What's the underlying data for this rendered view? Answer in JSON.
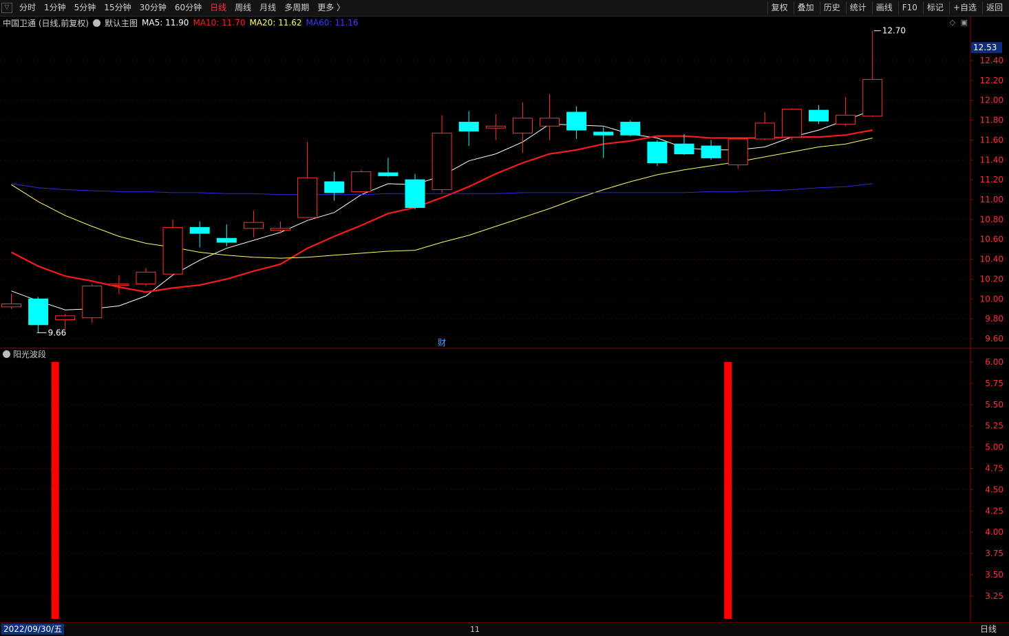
{
  "toolbar": {
    "periods": [
      "分时",
      "1分钟",
      "5分钟",
      "15分钟",
      "30分钟",
      "60分钟",
      "日线",
      "周线",
      "月线",
      "多周期",
      "更多 〉"
    ],
    "active_period": "日线",
    "buttons": [
      "复权",
      "叠加",
      "历史",
      "统计",
      "画线",
      "F10",
      "标记",
      "+自选",
      "返回"
    ]
  },
  "header": {
    "stock": "中国卫通 (日线,前复权)",
    "template": "默认主图",
    "ma5": "MA5: 11.90",
    "ma10": "MA10: 11.70",
    "ma20": "MA20: 11.62",
    "ma60": "MA60: 11.16"
  },
  "indicator_label": "阳光波段",
  "bottom": {
    "date": "2022/09/30/五",
    "month": "11",
    "period": "日线"
  },
  "colors": {
    "up": "#ff3232",
    "down": "#00ffff",
    "ma5": "#ffffff",
    "ma10": "#ff1a1a",
    "ma20": "#ffff66",
    "ma60": "#2a2ae6",
    "axis": "#8b0000",
    "bar": "#ff0000"
  },
  "chart_data": [
    {
      "type": "candlestick",
      "title": "中国卫通 (日线,前复权)",
      "ylim": [
        9.5,
        12.9
      ],
      "y_ticks": [
        9.6,
        9.8,
        10.0,
        10.2,
        10.4,
        10.6,
        10.8,
        11.0,
        11.2,
        11.4,
        11.6,
        11.8,
        12.0,
        12.2,
        12.4
      ],
      "current_price_tag": "12.53",
      "high_annotation": "12.70",
      "low_annotation": "9.66",
      "event_marker": "财",
      "candles": [
        {
          "o": 9.92,
          "h": 10.05,
          "l": 9.9,
          "c": 9.95
        },
        {
          "o": 10.0,
          "h": 10.02,
          "l": 9.66,
          "c": 9.74
        },
        {
          "o": 9.79,
          "h": 9.85,
          "l": 9.7,
          "c": 9.83
        },
        {
          "o": 9.81,
          "h": 10.15,
          "l": 9.76,
          "c": 10.13
        },
        {
          "o": 10.14,
          "h": 10.24,
          "l": 10.05,
          "c": 10.15
        },
        {
          "o": 10.15,
          "h": 10.31,
          "l": 10.13,
          "c": 10.27
        },
        {
          "o": 10.25,
          "h": 10.8,
          "l": 10.24,
          "c": 10.72
        },
        {
          "o": 10.72,
          "h": 10.78,
          "l": 10.52,
          "c": 10.66
        },
        {
          "o": 10.61,
          "h": 10.75,
          "l": 10.53,
          "c": 10.57
        },
        {
          "o": 10.71,
          "h": 10.89,
          "l": 10.62,
          "c": 10.77
        },
        {
          "o": 10.69,
          "h": 10.78,
          "l": 10.66,
          "c": 10.71
        },
        {
          "o": 10.82,
          "h": 11.58,
          "l": 10.82,
          "c": 11.22
        },
        {
          "o": 11.18,
          "h": 11.28,
          "l": 10.99,
          "c": 11.07
        },
        {
          "o": 11.08,
          "h": 11.3,
          "l": 11.07,
          "c": 11.28
        },
        {
          "o": 11.27,
          "h": 11.42,
          "l": 11.23,
          "c": 11.24
        },
        {
          "o": 11.2,
          "h": 11.26,
          "l": 10.9,
          "c": 10.92
        },
        {
          "o": 11.1,
          "h": 11.85,
          "l": 11.07,
          "c": 11.67
        },
        {
          "o": 11.78,
          "h": 11.89,
          "l": 11.54,
          "c": 11.69
        },
        {
          "o": 11.72,
          "h": 11.86,
          "l": 11.6,
          "c": 11.74
        },
        {
          "o": 11.67,
          "h": 11.98,
          "l": 11.47,
          "c": 11.82
        },
        {
          "o": 11.74,
          "h": 12.06,
          "l": 11.6,
          "c": 11.82
        },
        {
          "o": 11.88,
          "h": 11.94,
          "l": 11.61,
          "c": 11.7
        },
        {
          "o": 11.68,
          "h": 11.73,
          "l": 11.42,
          "c": 11.65
        },
        {
          "o": 11.78,
          "h": 11.8,
          "l": 11.64,
          "c": 11.65
        },
        {
          "o": 11.58,
          "h": 11.6,
          "l": 11.34,
          "c": 11.37
        },
        {
          "o": 11.56,
          "h": 11.66,
          "l": 11.45,
          "c": 11.46
        },
        {
          "o": 11.54,
          "h": 11.6,
          "l": 11.4,
          "c": 11.42
        },
        {
          "o": 11.35,
          "h": 11.62,
          "l": 11.31,
          "c": 11.61
        },
        {
          "o": 11.61,
          "h": 11.88,
          "l": 11.6,
          "c": 11.77
        },
        {
          "o": 11.63,
          "h": 11.92,
          "l": 11.6,
          "c": 11.91
        },
        {
          "o": 11.9,
          "h": 11.95,
          "l": 11.76,
          "c": 11.79
        },
        {
          "o": 11.76,
          "h": 12.03,
          "l": 11.74,
          "c": 11.85
        },
        {
          "o": 11.84,
          "h": 12.7,
          "l": 11.83,
          "c": 12.21
        }
      ],
      "ma_lines": [
        {
          "name": "MA5",
          "values": [
            10.08,
            9.98,
            9.89,
            9.9,
            9.93,
            10.03,
            10.24,
            10.39,
            10.51,
            10.59,
            10.67,
            10.79,
            10.87,
            11.05,
            11.16,
            11.15,
            11.24,
            11.39,
            11.46,
            11.58,
            11.76,
            11.75,
            11.74,
            11.66,
            11.62,
            11.52,
            11.5,
            11.5,
            11.53,
            11.63,
            11.7,
            11.8,
            11.9
          ]
        },
        {
          "name": "MA10",
          "values": [
            10.47,
            10.33,
            10.23,
            10.18,
            10.12,
            10.07,
            10.11,
            10.14,
            10.2,
            10.28,
            10.35,
            10.51,
            10.63,
            10.74,
            10.86,
            10.92,
            11.02,
            11.13,
            11.26,
            11.37,
            11.46,
            11.5,
            11.56,
            11.59,
            11.64,
            11.64,
            11.62,
            11.62,
            11.62,
            11.63,
            11.63,
            11.65,
            11.7
          ]
        },
        {
          "name": "MA20",
          "values": [
            11.15,
            10.98,
            10.84,
            10.73,
            10.63,
            10.56,
            10.52,
            10.47,
            10.44,
            10.42,
            10.41,
            10.42,
            10.44,
            10.46,
            10.48,
            10.49,
            10.57,
            10.64,
            10.73,
            10.82,
            10.91,
            11.01,
            11.1,
            11.18,
            11.25,
            11.3,
            11.34,
            11.38,
            11.43,
            11.48,
            11.53,
            11.56,
            11.62
          ]
        },
        {
          "name": "MA60",
          "values": [
            11.16,
            11.12,
            11.1,
            11.09,
            11.08,
            11.08,
            11.07,
            11.07,
            11.06,
            11.06,
            11.05,
            11.05,
            11.05,
            11.05,
            11.06,
            11.06,
            11.06,
            11.06,
            11.06,
            11.07,
            11.07,
            11.07,
            11.07,
            11.07,
            11.07,
            11.07,
            11.08,
            11.08,
            11.09,
            11.1,
            11.12,
            11.13,
            11.16
          ]
        }
      ]
    },
    {
      "type": "bar",
      "title": "阳光波段",
      "ylim": [
        3.0,
        6.2
      ],
      "y_ticks": [
        3.25,
        3.5,
        3.75,
        4.0,
        4.25,
        4.5,
        4.75,
        5.0,
        5.25,
        5.5,
        5.75,
        6.0
      ],
      "bars": [
        {
          "index": 2,
          "value": 6.0
        },
        {
          "index": 27,
          "value": 6.0
        }
      ]
    }
  ]
}
